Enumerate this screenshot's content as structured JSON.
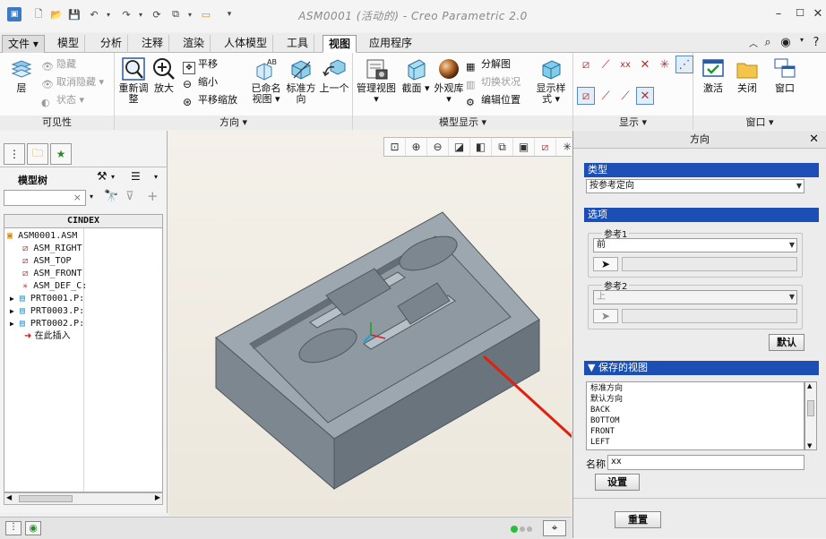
{
  "window": {
    "title": "ASM0001 (活动的) - Creo Parametric 2.0"
  },
  "menu": {
    "tabs": [
      {
        "label": "文件 ▾"
      },
      {
        "label": "模型"
      },
      {
        "label": "分析"
      },
      {
        "label": "注释"
      },
      {
        "label": "渲染"
      },
      {
        "label": "人体模型"
      },
      {
        "label": "工具"
      },
      {
        "label": "视图"
      },
      {
        "label": "应用程序"
      }
    ],
    "active_tab": "视图"
  },
  "ribbon": {
    "visibility": {
      "layer_label": "层",
      "hide_label": "隐藏",
      "unhide_label": "取消隐藏",
      "status_label": "状态",
      "footer": "可见性"
    },
    "orientation": {
      "refit_label": "重新调整",
      "zoom_in_label": "放大",
      "pan_label": "平移",
      "zoom_out_label": "缩小",
      "pan_zoom_label": "平移缩放",
      "named_views_label": "已命名视图",
      "standard_orientation_label": "标准方向",
      "previous_label": "上一个",
      "footer": "方向 ▾"
    },
    "model_display": {
      "manage_views_label": "管理视图",
      "section_label": "截面",
      "appearance_label": "外观库",
      "explode_label": "分解图",
      "toggle_status_label": "切换状况",
      "edit_position_label": "编辑位置",
      "display_style_label": "显示样式",
      "footer": "模型显示 ▾"
    },
    "show": {
      "footer": "显示 ▾"
    },
    "window": {
      "activate_label": "激活",
      "close_label": "关闭",
      "window_label": "窗口",
      "footer": "窗口 ▾"
    }
  },
  "model_tree": {
    "title": "模型树",
    "column_header": "CINDEX",
    "items": [
      {
        "label": "ASM0001.ASM"
      },
      {
        "label": "ASM_RIGHT"
      },
      {
        "label": "ASM_TOP"
      },
      {
        "label": "ASM_FRONT"
      },
      {
        "label": "ASM_DEF_C:"
      },
      {
        "label": "PRT0001.P:"
      },
      {
        "label": "PRT0003.P:"
      },
      {
        "label": "PRT0002.P:"
      },
      {
        "label": "在此插入"
      }
    ]
  },
  "dialog": {
    "title": "方向",
    "type_header": "类型",
    "type_value": "按参考定向",
    "options_header": "选项",
    "reference1_label": "参考1",
    "reference1_value": "前",
    "reference2_label": "参考2",
    "reference2_value": "上",
    "default_button": "默认",
    "saved_views_header": "保存的视图",
    "saved_views": [
      "标准方向",
      "默认方向",
      "BACK",
      "BOTTOM",
      "FRONT",
      "LEFT"
    ],
    "name_label": "名称",
    "name_value": "xx",
    "set_button": "设置",
    "reset_button": "重置"
  },
  "colors": {
    "section_header": "#1b4fb5",
    "model_top": "#9aa5ad",
    "model_side": "#6a747c",
    "model_front": "#7d878f",
    "arrow": "#e02010"
  }
}
